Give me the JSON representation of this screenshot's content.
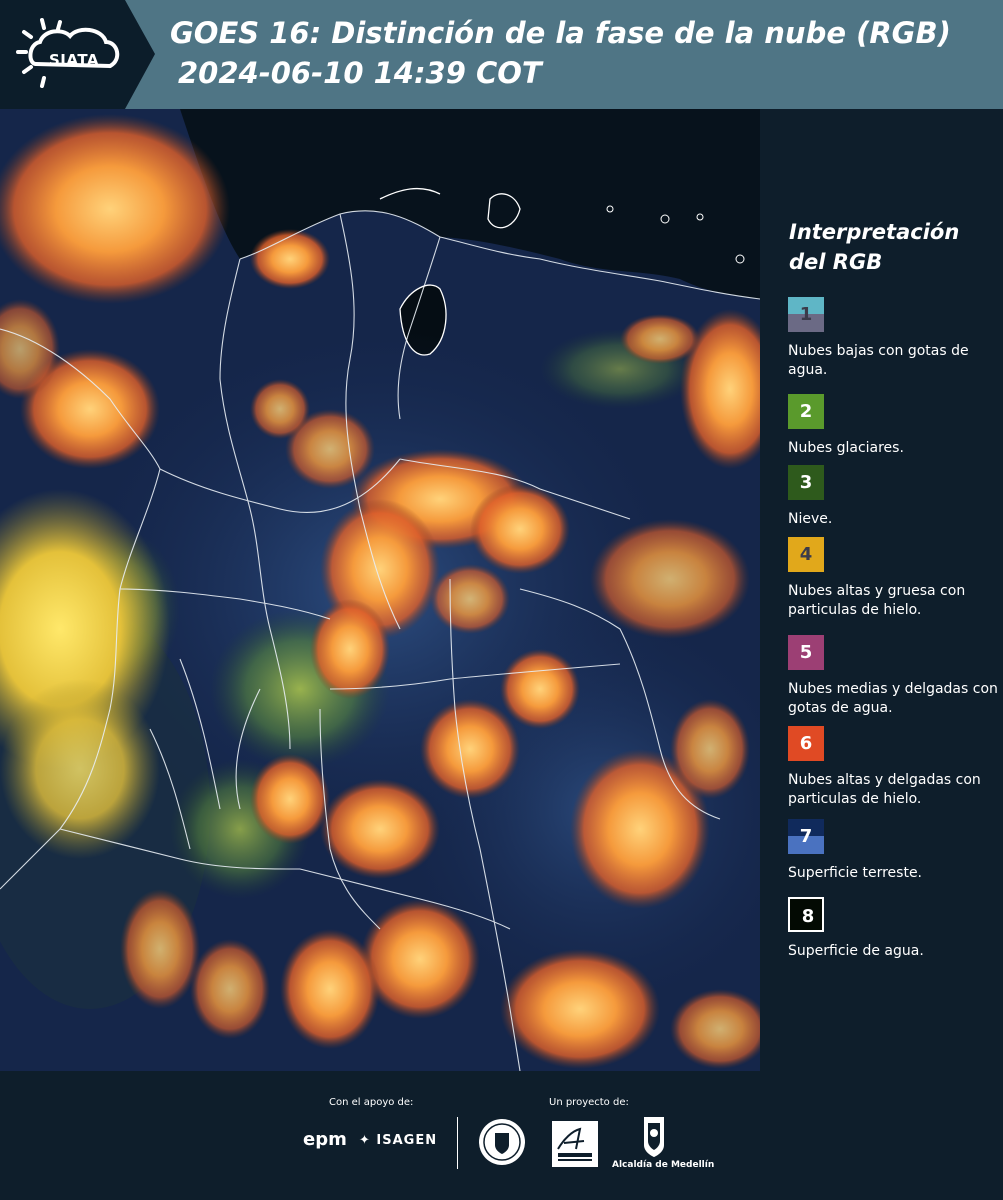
{
  "header": {
    "logo_text": "SIATA",
    "title_line1": "GOES 16: Distinción de la fase de la nube (RGB)",
    "title_line2": "2024-06-10 14:39 COT",
    "band_color": "#4f7585"
  },
  "legend": {
    "title": "Interpretación del RGB",
    "items": [
      {
        "number": "1",
        "label": "Nubes bajas con gotas de agua.",
        "color_top": "#5fb6c6",
        "color_bottom": "#6b6a85",
        "num_color": "#3b3b4a"
      },
      {
        "number": "2",
        "label": "Nubes glaciares.",
        "color_top": "#5a9a2c",
        "color_bottom": "#5a9a2c",
        "num_color": "#ffffff"
      },
      {
        "number": "3",
        "label": "Nieve.",
        "color_top": "#2e5a1c",
        "color_bottom": "#2e5a1c",
        "num_color": "#ffffff"
      },
      {
        "number": "4",
        "label": "Nubes altas y gruesa con particulas de hielo.",
        "color_top": "#e1a81b",
        "color_bottom": "#e1a81b",
        "num_color": "#3b3b4a"
      },
      {
        "number": "5",
        "label": "Nubes medias y delgadas con gotas de agua.",
        "color_top": "#9c3f74",
        "color_bottom": "#9c3f74",
        "num_color": "#ffffff"
      },
      {
        "number": "6",
        "label": "Nubes altas y delgadas con particulas de hielo.",
        "color_top": "#e04a24",
        "color_bottom": "#e04a24",
        "num_color": "#ffffff"
      },
      {
        "number": "7",
        "label": "Superficie terreste.",
        "color_top": "#102a5c",
        "color_bottom": "#4a72c0",
        "num_color": "#ffffff"
      },
      {
        "number": "8",
        "label": "Superficie de agua.",
        "color_top": "#030a03",
        "color_bottom": "#030a03",
        "num_color": "#ffffff"
      }
    ]
  },
  "footer": {
    "support_label": "Con el apoyo de:",
    "project_label": "Un proyecto de:",
    "sponsor_1": "epm",
    "sponsor_2": "ISAGEN",
    "partner_3": "Alcaldía de Medellín"
  }
}
